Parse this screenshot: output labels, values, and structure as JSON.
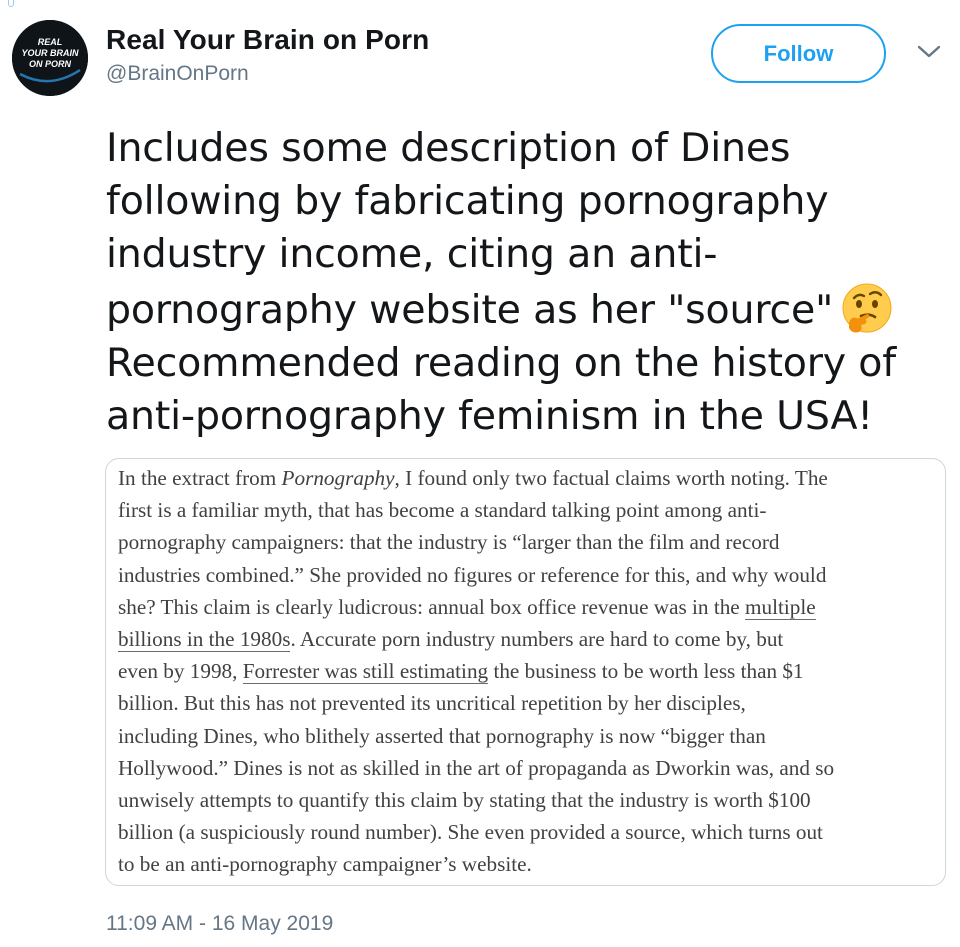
{
  "author": {
    "display_name": "Real Your Brain on Porn",
    "handle": "@BrainOnPorn",
    "avatar_text": [
      "REAL",
      "YOUR BRAIN",
      "ON PORN"
    ]
  },
  "follow_label": "Follow",
  "tweet_lines": [
    "Includes some description of Dines",
    "following by fabricating pornography",
    "industry income, citing an anti-",
    "pornography website as her \"source\"",
    "Recommended reading on the history of",
    "anti-pornography feminism in the USA!"
  ],
  "emoji": "thinking-face",
  "quote": {
    "l1_pre": "In the extract from ",
    "l1_em": "Pornography",
    "l1_post": ", I found only two factual claims worth noting. The",
    "l2": "first is a familiar myth, that has become a standard talking point among anti-",
    "l3": "pornography campaigners: that the industry is “larger than the film and record",
    "l4": "industries combined.” She provided no figures or reference for this, and why would",
    "l5_pre": "she? This claim is clearly ludicrous: annual box office revenue was in the ",
    "l5_link": "multiple",
    "l6_link": "billions in the 1980s",
    "l6_post": ". Accurate porn industry numbers are hard to come by, but",
    "l7_pre": "even by 1998, ",
    "l7_link": "Forrester was still estimating",
    "l7_post": " the business to be worth less than $1",
    "l8": "billion. But this has not prevented its uncritical repetition by her disciples,",
    "l9": "including Dines, who blithely asserted that pornography is now “bigger than",
    "l10": "Hollywood.” Dines is not as skilled in the art of propaganda as Dworkin was, and so",
    "l11": "unwisely attempts to quantify this claim by stating that the industry is worth $100",
    "l12": "billion (a suspiciously round number). She even provided a source, which turns out",
    "l13": "to be an anti-pornography campaigner’s website."
  },
  "timestamp": "11:09 AM - 16 May 2019",
  "colors": {
    "accent": "#1da1f2",
    "text": "#14171a",
    "secondary": "#657786",
    "avatar_bg": "#0f1419"
  }
}
